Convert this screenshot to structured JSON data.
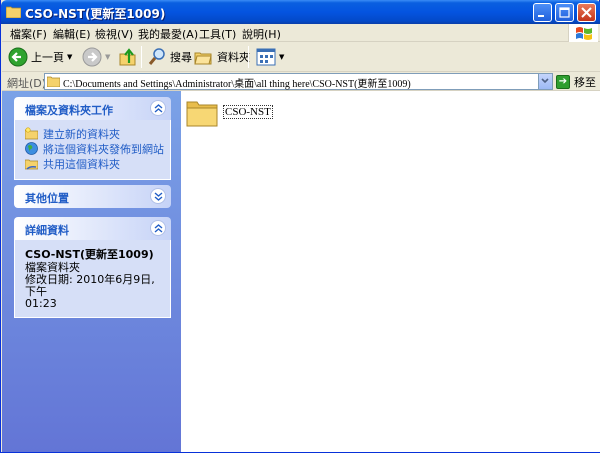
{
  "window": {
    "title": "CSO-NST(更新至1009)"
  },
  "menubar": {
    "items": [
      "檔案(F)",
      "編輯(E)",
      "檢視(V)",
      "我的最愛(A)",
      "工具(T)",
      "說明(H)"
    ]
  },
  "toolbar": {
    "back_label": "上一頁",
    "search_label": "搜尋",
    "folders_label": "資料夾"
  },
  "address": {
    "label": "網址(D)",
    "path": "C:\\Documents and Settings\\Administrator\\桌面\\all thing here\\CSO-NST(更新至1009)",
    "go_label": "移至"
  },
  "taskpane": {
    "file_tasks": {
      "title": "檔案及資料夾工作",
      "links": [
        "建立新的資料夾",
        "將這個資料夾發佈到網站",
        "共用這個資料夾"
      ]
    },
    "other_places": {
      "title": "其他位置"
    },
    "details": {
      "title": "詳細資料",
      "name": "CSO-NST(更新至1009)",
      "type": "檔案資料夾",
      "modified_line1": "修改日期: 2010年6月9日, 下午",
      "modified_line2": "01:23"
    }
  },
  "content": {
    "items": [
      {
        "name": "CSO-NST"
      }
    ]
  },
  "colors": {
    "titlebar": "#0454e0",
    "taskpane_top": "#7ba2e7",
    "taskpane_bottom": "#6375d6",
    "link": "#215dc6",
    "folder": "#f5d26b"
  }
}
